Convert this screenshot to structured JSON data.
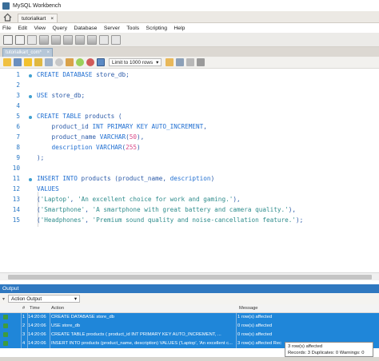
{
  "window": {
    "title": "MySQL Workbench"
  },
  "connection_tab": {
    "label": "tutorialkart",
    "close": "×"
  },
  "menu": [
    "File",
    "Edit",
    "View",
    "Query",
    "Database",
    "Server",
    "Tools",
    "Scripting",
    "Help"
  ],
  "file_tab": {
    "label": "tutorialkart_com*",
    "close": "×"
  },
  "query_toolbar": {
    "limit_label": "Limit to 1000 rows"
  },
  "editor": {
    "lines": [
      {
        "n": "1",
        "html": "<span class='kw'>CREATE DATABASE</span> store_db;",
        "dot": true
      },
      {
        "n": "2",
        "html": "",
        "dot": false
      },
      {
        "n": "3",
        "html": "<span class='kw'>USE</span> store_db;",
        "dot": true
      },
      {
        "n": "4",
        "html": "",
        "dot": false
      },
      {
        "n": "5",
        "html": "<span class='kw'>CREATE TABLE</span> products (",
        "dot": true
      },
      {
        "n": "6",
        "html": "    product_id <span class='kw'>INT PRIMARY KEY AUTO_INCREMENT</span>,",
        "dot": false
      },
      {
        "n": "7",
        "html": "    product_name <span class='kw'>VARCHAR</span>(<span class='num'>50</span>),",
        "dot": false
      },
      {
        "n": "8",
        "html": "    <span class='kw'>description VARCHAR</span>(<span class='num'>255</span>)",
        "dot": false
      },
      {
        "n": "9",
        "html": ");",
        "dot": false
      },
      {
        "n": "10",
        "html": "",
        "dot": false
      },
      {
        "n": "11",
        "html": "<span class='kw'>INSERT INTO</span> products (product_name, <span class='kw'>description</span>)",
        "dot": true
      },
      {
        "n": "12",
        "html": "<span class='kw'>VALUES</span>",
        "dot": false
      },
      {
        "n": "13",
        "html": "(<span class='str'>'Laptop'</span>, <span class='str'>'An excellent choice for work and gaming.'</span>),",
        "dot": false
      },
      {
        "n": "14",
        "html": "(<span class='str'>'Smartphone'</span>, <span class='str'>'A smartphone with great battery and camera quality.'</span>),",
        "dot": false
      },
      {
        "n": "15",
        "html": "(<span class='str'>'Headphones'</span>, <span class='str'>'Premium sound quality and noise-cancellation feature.'</span>);",
        "dot": false
      }
    ]
  },
  "output": {
    "panel_title": "Output",
    "dropdown": "Action Output",
    "columns": [
      "#",
      "Time",
      "Action",
      "Message"
    ],
    "rows": [
      {
        "num": "1",
        "time": "14:20:06",
        "action": "CREATE DATABASE store_db",
        "message": "1 row(s) affected"
      },
      {
        "num": "2",
        "time": "14:20:06",
        "action": "USE store_db",
        "message": "0 row(s) affected"
      },
      {
        "num": "3",
        "time": "14:20:06",
        "action": "CREATE TABLE products (    product_id INT PRIMARY KEY AUTO_INCREMENT,   ...",
        "message": "0 row(s) affected"
      },
      {
        "num": "4",
        "time": "14:20:06",
        "action": "INSERT INTO products (product_name, description) VALUES  ('Laptop', 'An excellent c...",
        "message": "3 row(s) affected Rec"
      }
    ],
    "tooltip": {
      "line1": "3 row(s) affected",
      "line2": "Records: 3  Duplicates: 0  Warnings: 0"
    }
  },
  "colors": {
    "selection": "#1f86d9",
    "keyword": "#1f6ed1",
    "string": "#2f8c8c",
    "number": "#d94a8a",
    "line_number": "#2a78c5"
  }
}
